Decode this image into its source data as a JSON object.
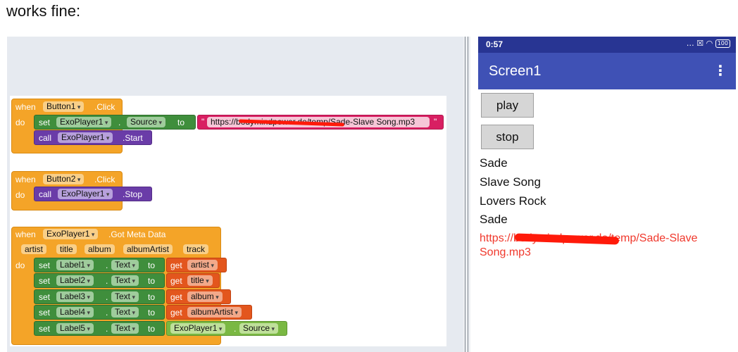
{
  "intro_text": "works fine:",
  "blocks": {
    "event1": {
      "when": "when",
      "component": "Button1",
      "event": ".Click",
      "do": "do",
      "set1": {
        "set": "set",
        "component": "ExoPlayer1",
        "property": "Source",
        "to": "to",
        "string_value": "https://bodymindpower.de/temp/Sade-Slave Song.mp3"
      },
      "call1": {
        "call": "call",
        "component": "ExoPlayer1",
        "method": ".Start"
      }
    },
    "event2": {
      "when": "when",
      "component": "Button2",
      "event": ".Click",
      "do": "do",
      "call1": {
        "call": "call",
        "component": "ExoPlayer1",
        "method": ".Stop"
      }
    },
    "event3": {
      "when": "when",
      "component": "ExoPlayer1",
      "event": ".Got Meta Data",
      "do": "do",
      "params": [
        "artist",
        "title",
        "album",
        "albumArtist",
        "track"
      ],
      "sets": [
        {
          "set": "set",
          "component": "Label1",
          "property": "Text",
          "to": "to",
          "get": "get",
          "value": "artist"
        },
        {
          "set": "set",
          "component": "Label2",
          "property": "Text",
          "to": "to",
          "get": "get",
          "value": "title"
        },
        {
          "set": "set",
          "component": "Label3",
          "property": "Text",
          "to": "to",
          "get": "get",
          "value": "album"
        },
        {
          "set": "set",
          "component": "Label4",
          "property": "Text",
          "to": "to",
          "get": "get",
          "value": "albumArtist"
        },
        {
          "set": "set",
          "component": "Label5",
          "property": "Text",
          "to": "to",
          "value_component": "ExoPlayer1",
          "value_property": "Source"
        }
      ]
    }
  },
  "phone": {
    "time": "0:57",
    "status_icons": "… ☒ ◠",
    "battery": "100",
    "title": "Screen1",
    "menu_icon": "⋮",
    "buttons": {
      "play": "play",
      "stop": "stop"
    },
    "labels": [
      "Sade",
      "Slave Song",
      "Lovers Rock",
      "Sade"
    ],
    "url_text": "https://bodymindpower.de/temp/Sade-Slave Song.mp3"
  },
  "colors": {
    "event_block": "#f4a428",
    "set_block": "#3f8e3c",
    "call_block": "#6a3ca8",
    "get_block": "#e3561d",
    "string_block": "#d81f62",
    "getter_block": "#7ab843",
    "status_bar": "#283593",
    "app_bar": "#3f51b5",
    "url_text": "#f0382c"
  }
}
